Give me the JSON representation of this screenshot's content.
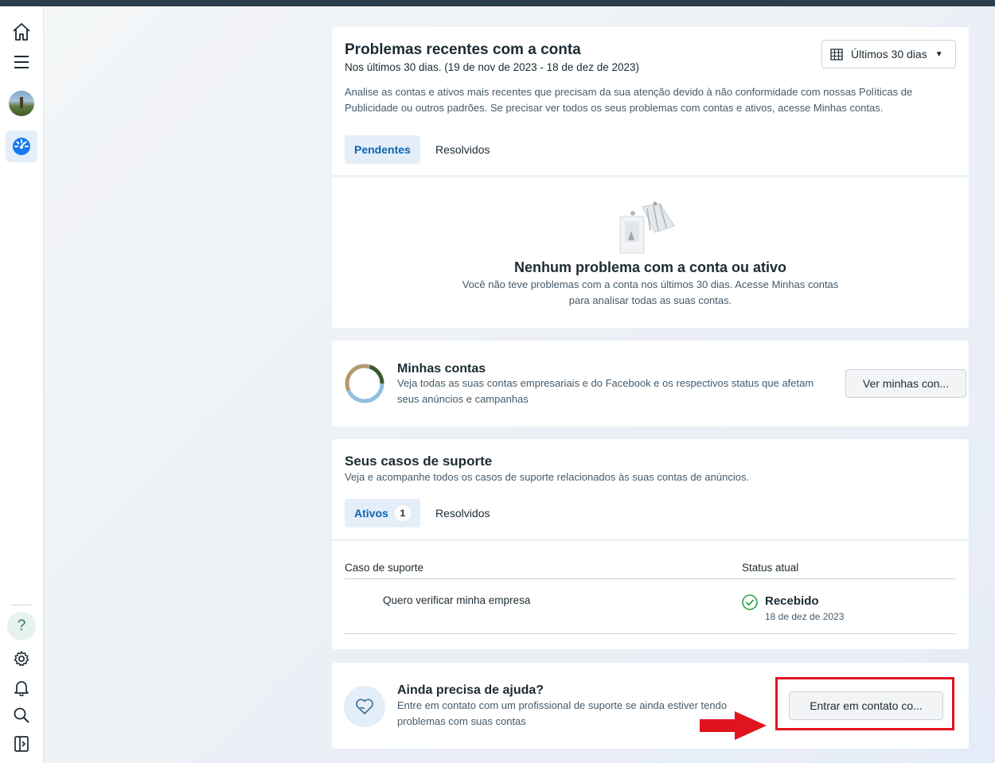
{
  "nav": {
    "icons": [
      "home-icon",
      "menu-icon",
      "avatar",
      "dashboard-icon",
      "help-icon",
      "settings-icon",
      "bell-icon",
      "search-icon",
      "panel-icon"
    ],
    "help_label": "?"
  },
  "issues": {
    "title": "Problemas recentes com a conta",
    "subtitle": "Nos últimos 30 dias. (19 de nov de 2023 - 18 de dez de 2023)",
    "description": "Analise as contas e ativos mais recentes que precisam da sua atenção devido à não conformidade com nossas Políticas de Publicidade ou outros padrões. Se precisar ver todos os seus problemas com contas e ativos, acesse Minhas contas.",
    "date_filter": "Últimos 30 dias",
    "tabs": [
      {
        "label": "Pendentes",
        "active": true
      },
      {
        "label": "Resolvidos",
        "active": false
      }
    ],
    "empty_title": "Nenhum problema com a conta ou ativo",
    "empty_text": "Você não teve problemas com a conta nos últimos 30 dias. Acesse Minhas contas para analisar todas as suas contas."
  },
  "accounts": {
    "title": "Minhas contas",
    "description": "Veja todas as suas contas empresariais e do Facebook e os respectivos status que afetam seus anúncios e campanhas",
    "button": "Ver minhas con..."
  },
  "support": {
    "title": "Seus casos de suporte",
    "subtitle": "Veja e acompanhe todos os casos de suporte relacionados às suas contas de anúncios.",
    "tabs": [
      {
        "label": "Ativos",
        "count": "1",
        "active": true
      },
      {
        "label": "Resolvidos",
        "active": false
      }
    ],
    "columns": [
      "Caso de suporte",
      "Status atual"
    ],
    "rows": [
      {
        "case": "Quero verificar minha empresa",
        "status": "Recebido",
        "date": "18 de dez de 2023"
      }
    ]
  },
  "help": {
    "title": "Ainda precisa de ajuda?",
    "description": "Entre em contato com um profissional de suporte se ainda estiver tendo problemas com suas contas",
    "button": "Entrar em contato co..."
  },
  "colors": {
    "accent": "#0a66b0",
    "success": "#31a24c",
    "annotation": "#e0141e"
  }
}
